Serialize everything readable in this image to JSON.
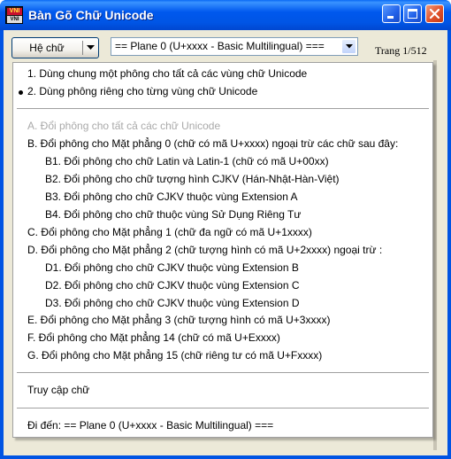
{
  "window": {
    "title": "Bàn Gõ Chữ Unicode",
    "icon_text_top": "VNI",
    "icon_text_bottom": "VNI",
    "controls": [
      "minimize-icon",
      "maximize-icon",
      "close-icon"
    ],
    "accent_color": "#0054e3"
  },
  "toolbar": {
    "font_button_label": "Hệ chữ",
    "plane_select_value": "== Plane 0 (U+xxxx - Basic Multilingual) ===",
    "page_indicator": "Trang 1/512"
  },
  "menu": {
    "options": [
      "1. Dùng chung một phông cho tất cả các vùng chữ Unicode",
      "2. Dùng phông riêng cho từng vùng chữ Unicode"
    ],
    "selected_option_index": 1,
    "items": [
      "A. Đổi phông cho tất cả các chữ Unicode",
      "B.  Đổi phông cho Mặt phẳng 0 (chữ có mã U+xxxx) ngoại trừ các chữ sau đây:",
      "B1. Đổi phông cho chữ Latin và Latin-1 (chữ có mã U+00xx)",
      "B2.  Đổi phông cho chữ tượng hình CJKV (Hán-Nhật-Hàn-Việt)",
      "B3. Đổi phông cho chữ CJKV thuộc vùng Extension A",
      "B4.  Đổi phông cho chữ thuộc vùng Sử Dụng Riêng Tư",
      "C.  Đổi phông cho Mặt phẳng 1 (chữ đa ngữ có mã U+1xxxx)",
      "D.  Đổi phông cho Mặt phẳng 2 (chữ tượng hình có mã U+2xxxx) ngoại trừ :",
      "D1. Đổi phông cho chữ CJKV thuộc vùng Extension B",
      "D2. Đổi phông cho chữ CJKV thuộc vùng Extension C",
      "D3. Đổi phông cho chữ CJKV thuộc vùng Extension D",
      "E.  Đổi phông cho Mặt phẳng 3 (chữ tượng hình có mã U+3xxxx)",
      "F.  Đổi phông cho Mặt phẳng 14 (chữ có mã U+Exxxx)",
      "G.  Đổi phông cho Mặt phẳng 15 (chữ riêng tư có mã U+Fxxxx)"
    ],
    "disabled_items": [
      0
    ],
    "access_label": "Truy cập chữ",
    "goto_label": "Đi đến: == Plane 0 (U+xxxx - Basic Multilingual) ==="
  }
}
